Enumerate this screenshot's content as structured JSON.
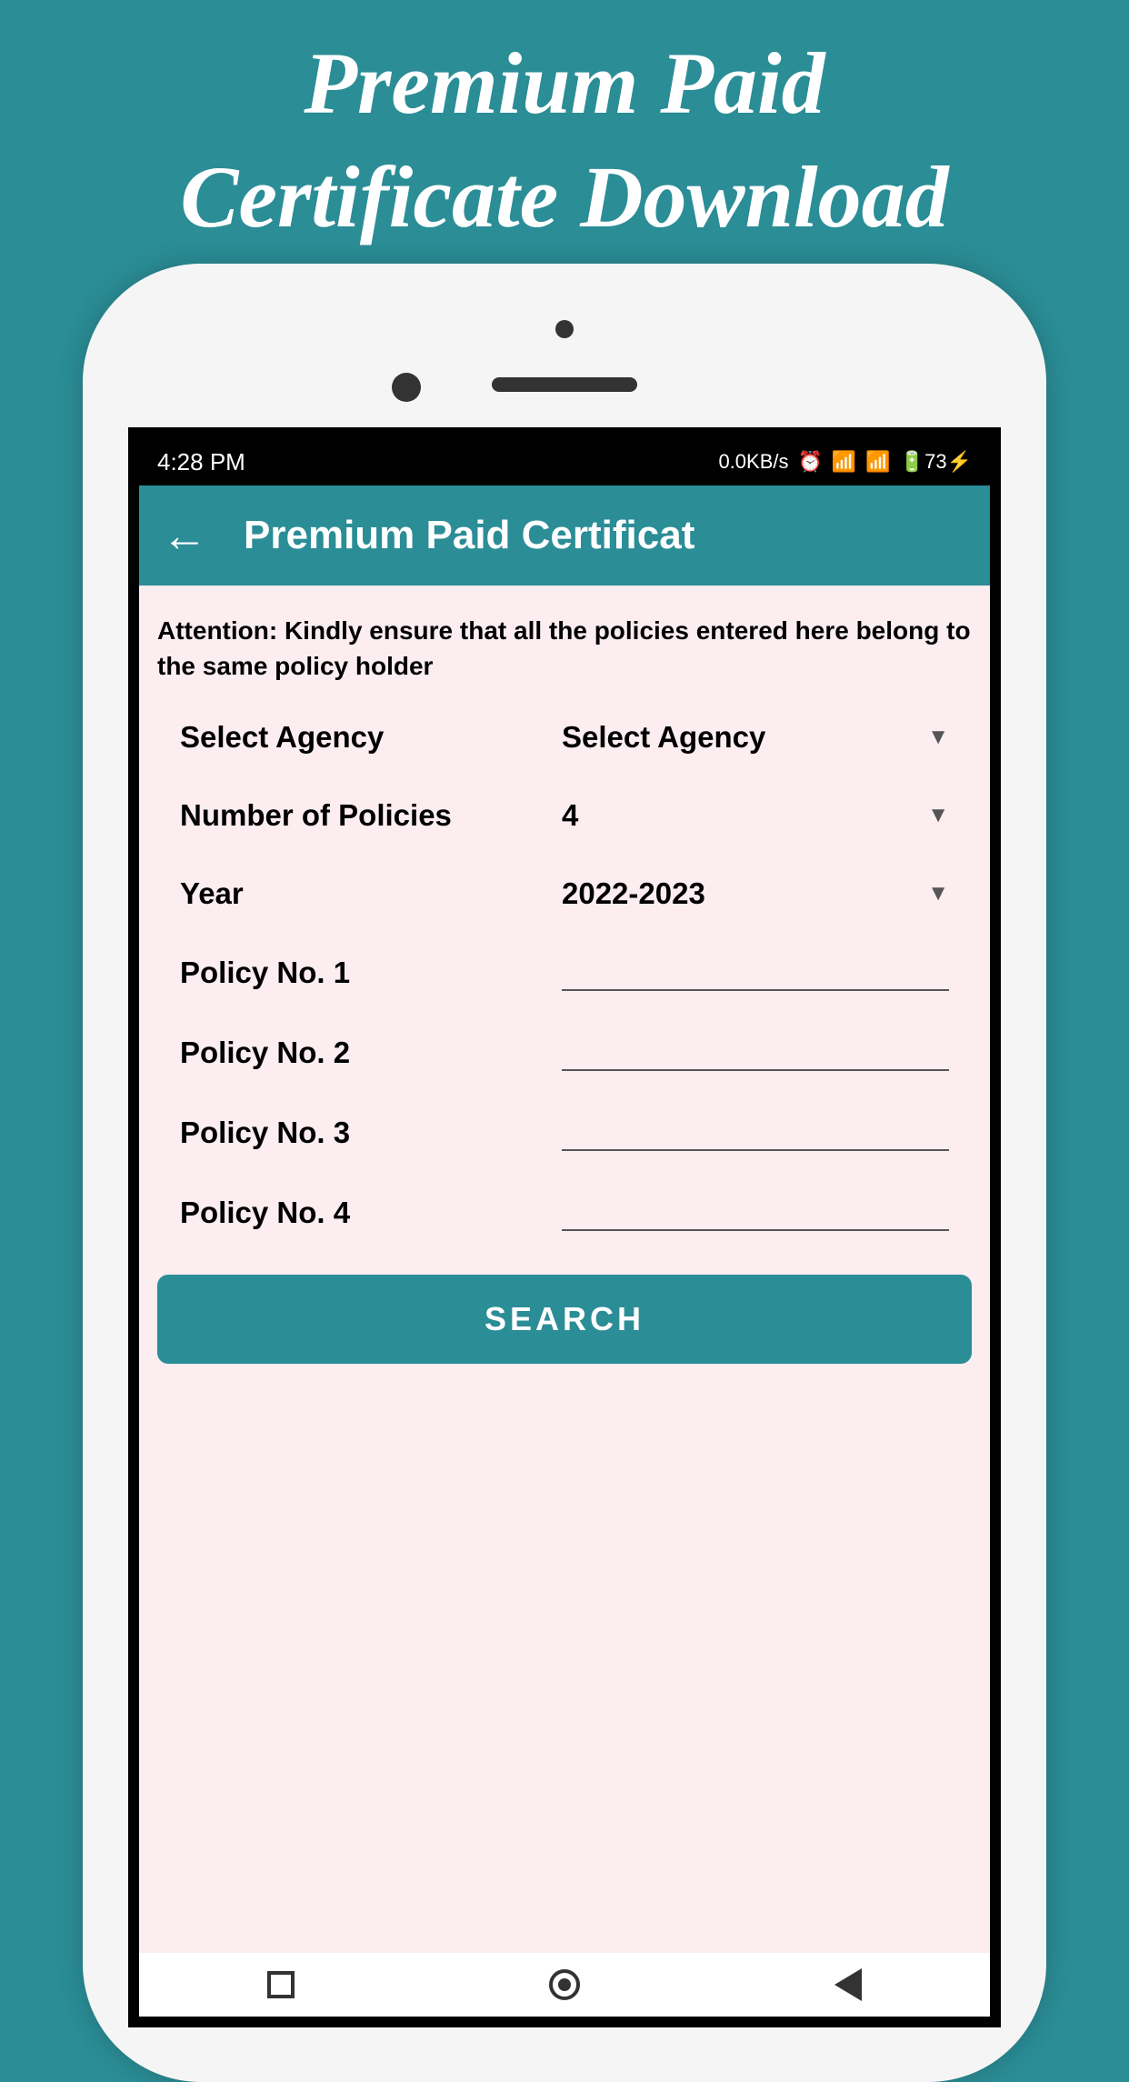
{
  "promo": {
    "line1": "Premium Paid",
    "line2": "Certificate Download"
  },
  "statusBar": {
    "time": "4:28 PM",
    "network": "0.0KB/s",
    "battery": "73"
  },
  "header": {
    "title": "Premium Paid Certificat"
  },
  "attention": "Attention: Kindly ensure that all the policies entered here belong to the same policy holder",
  "form": {
    "agency": {
      "label": "Select Agency",
      "value": "Select Agency"
    },
    "policies": {
      "label": "Number of Policies",
      "value": "4"
    },
    "year": {
      "label": "Year",
      "value": "2022-2023"
    },
    "policy1": {
      "label": "Policy No. 1",
      "value": ""
    },
    "policy2": {
      "label": "Policy No. 2",
      "value": ""
    },
    "policy3": {
      "label": "Policy No. 3",
      "value": ""
    },
    "policy4": {
      "label": "Policy No. 4",
      "value": ""
    },
    "searchButton": "SEARCH"
  }
}
